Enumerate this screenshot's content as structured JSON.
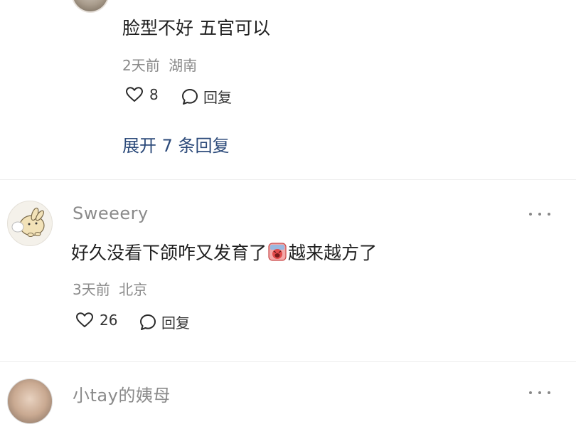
{
  "comments": [
    {
      "text": "脸型不好 五官可以",
      "time": "2天前",
      "location": "湖南",
      "likes": "8",
      "reply_label": "回复",
      "expand_label": "展开 7 条回复"
    },
    {
      "username": "Sweeery",
      "text_before": "好久没看下颌咋又发育了",
      "text_after": "越来越方了",
      "time": "3天前",
      "location": "北京",
      "likes": "26",
      "reply_label": "回复"
    },
    {
      "username": "小tay的姨母"
    }
  ],
  "icons": {
    "like": "heart-outline-icon",
    "reply": "comment-bubble-icon",
    "more": "more-dots-icon",
    "emoji": "crying-face-emoji"
  },
  "colors": {
    "expand_link": "#2c4a7a",
    "meta_text": "#8a8a8a"
  }
}
